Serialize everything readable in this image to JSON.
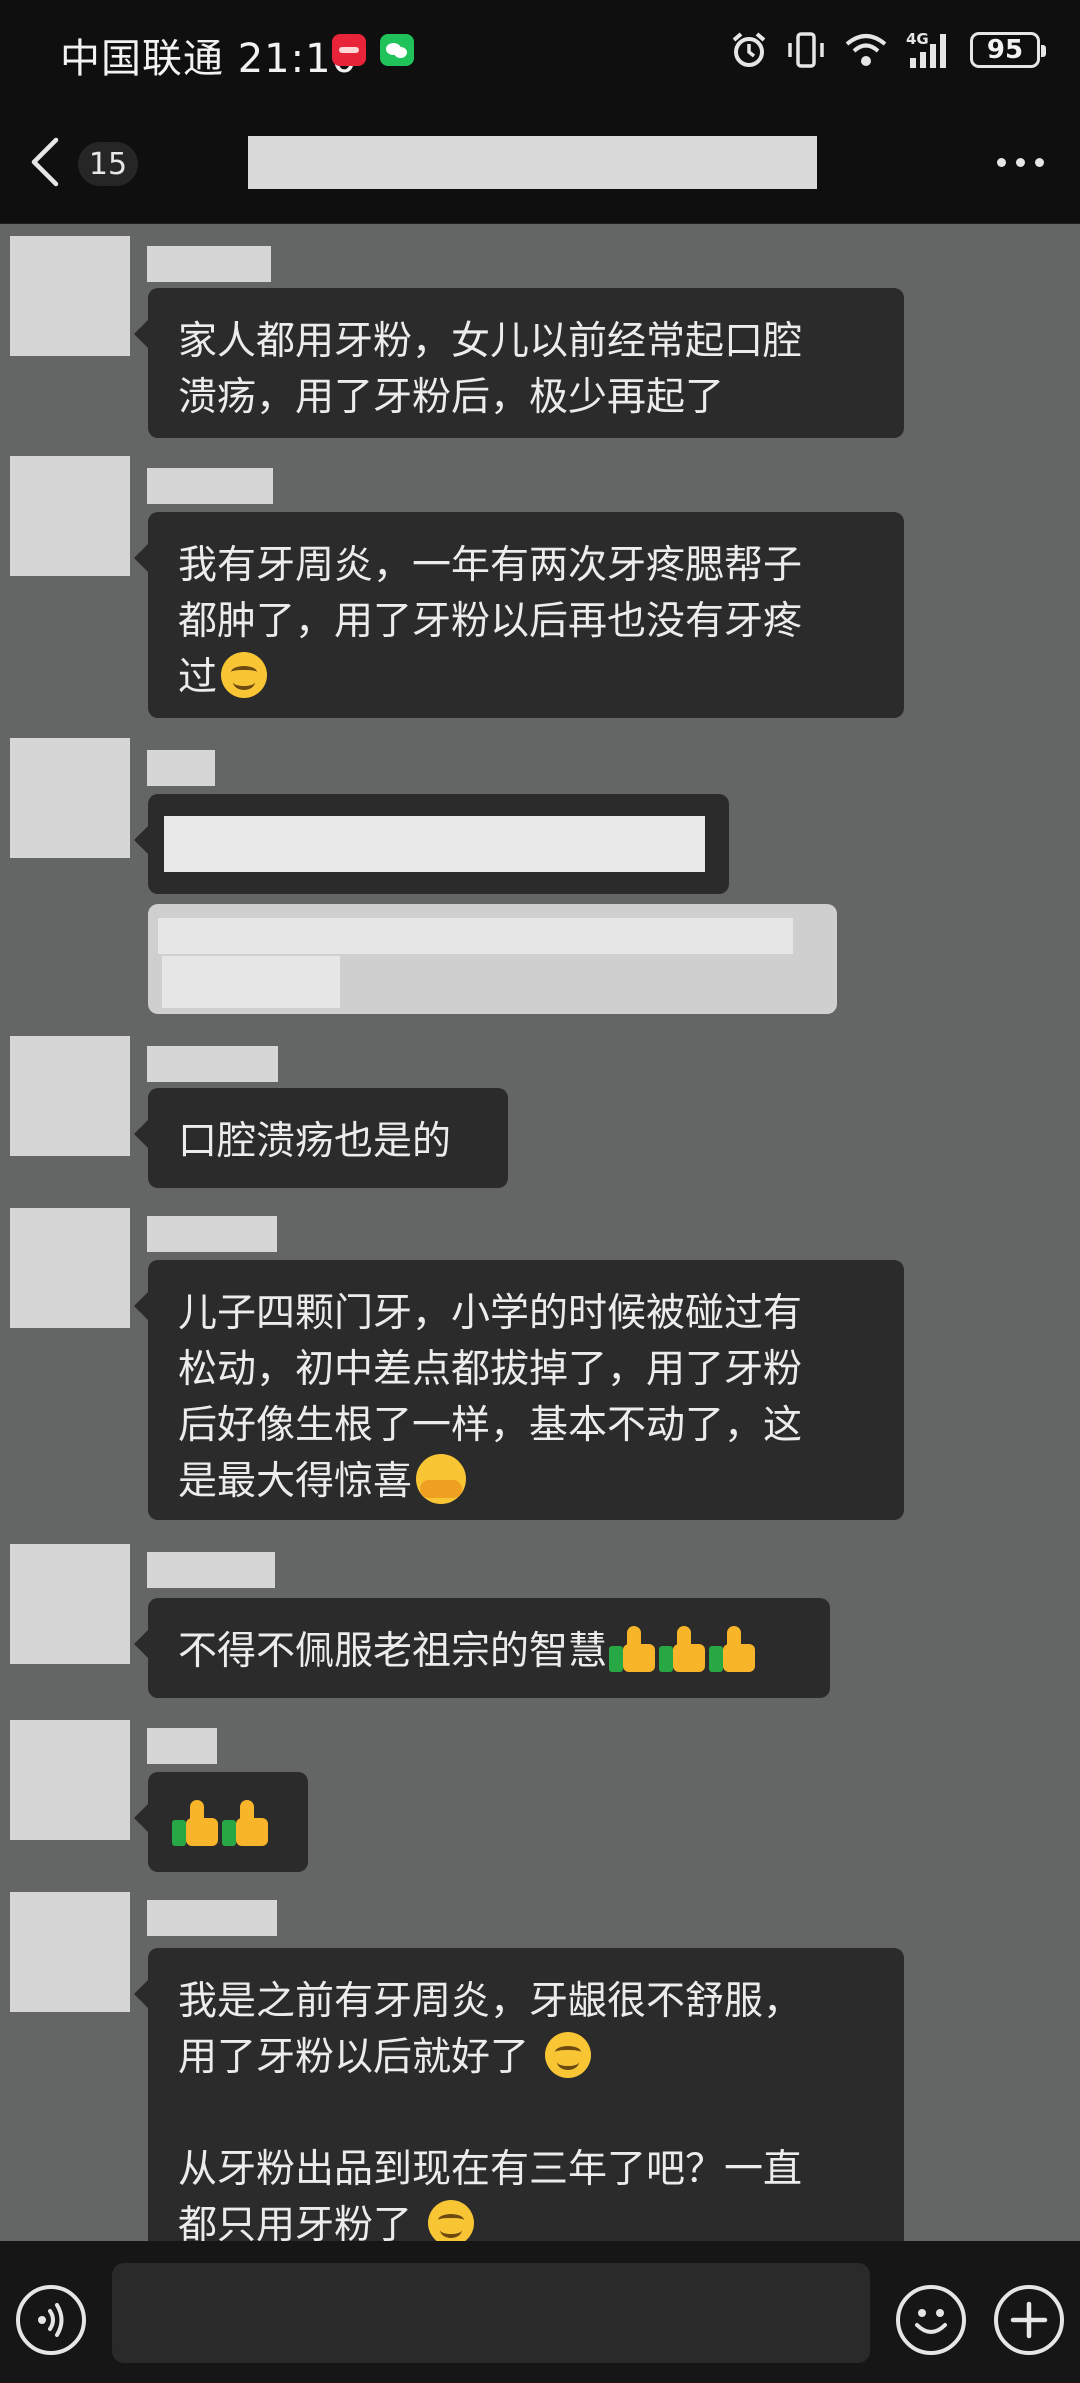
{
  "status_bar": {
    "carrier": "中国联通",
    "time": "21:10",
    "network": "4G",
    "battery": "95"
  },
  "header": {
    "unread_count": "15"
  },
  "messages": [
    {
      "text": "家人都用牙粉，女儿以前经常起口腔\n溃疡，用了牙粉后，极少再起了"
    },
    {
      "text": "我有牙周炎，一年有两次牙疼腮帮子\n都肿了，用了牙粉以后再也没有牙疼\n过"
    },
    {
      "text": ""
    },
    {
      "text": "口腔溃疡也是的"
    },
    {
      "text": "儿子四颗门牙，小学的时候被碰过有\n松动，初中差点都拔掉了，用了牙粉\n后好像生根了一样，基本不动了，这\n是最大得惊喜"
    },
    {
      "text": "不得不佩服老祖宗的智慧"
    },
    {
      "text": ""
    },
    {
      "text_1": "我是之前有牙周炎，牙龈很不舒服，\n用了牙粉以后就好了 ",
      "text_2": "从牙粉出品到现在有三年了吧？一直\n都只用牙粉了 "
    }
  ],
  "emojis": {
    "smile": "smile-emoji",
    "hug": "hug-emoji",
    "thumbs_up": "thumbs-up-emoji"
  }
}
